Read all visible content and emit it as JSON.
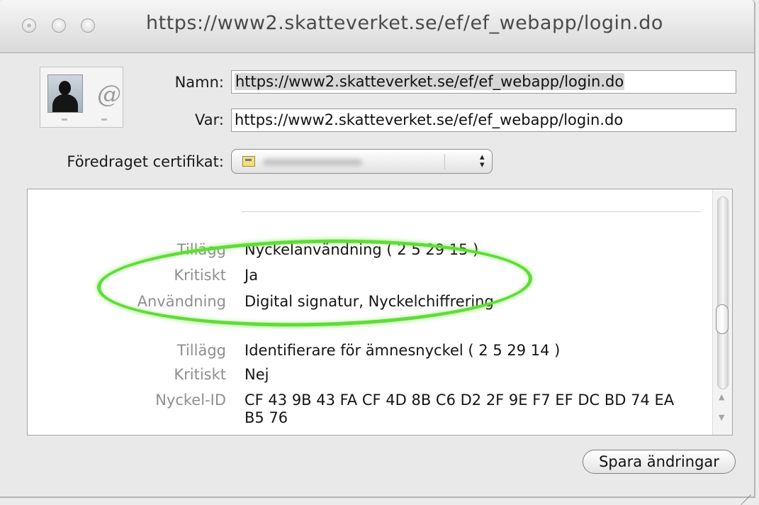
{
  "window": {
    "title": "https://www2.skatteverket.se/ef/ef_webapp/login.do"
  },
  "identity": {
    "name_label": "Namn:",
    "name_value": "https://www2.skatteverket.se/ef/ef_webapp/login.do",
    "where_label": "Var:",
    "where_value": "https://www2.skatteverket.se/ef/ef_webapp/login.do"
  },
  "preferred_certificate": {
    "label": "Föredraget certifikat:",
    "icon": "certificate-icon"
  },
  "details": [
    {
      "key": "Tillägg",
      "value": "Nyckelanvändning ( 2 5 29 15 )"
    },
    {
      "key": "Kritiskt",
      "value": "Ja"
    },
    {
      "key": "Användning",
      "value": "Digital signatur, Nyckelchiffrering"
    },
    {
      "key": "Tillägg",
      "value": "Identifierare för ämnesnyckel ( 2 5 29 14 )"
    },
    {
      "key": "Kritiskt",
      "value": "Nej"
    },
    {
      "key": "Nyckel-ID",
      "value": "CF 43 9B 43 FA CF 4D 8B C6 D2 2F 9E F7 EF DC BD 74 EA B5 76"
    }
  ],
  "actions": {
    "save_label": "Spara ändringar"
  },
  "colors": {
    "highlight": "#5fdc39",
    "key_text": "#8f8f8f"
  }
}
